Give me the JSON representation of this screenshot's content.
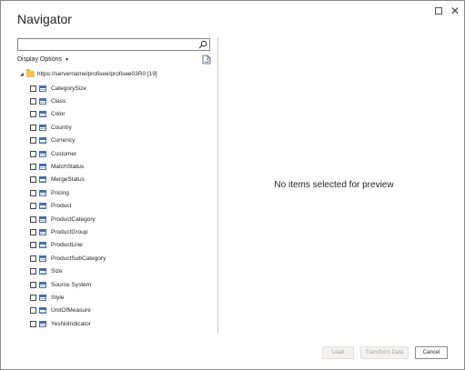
{
  "window": {
    "title": "Navigator"
  },
  "left_pane": {
    "search_placeholder": "",
    "display_options_label": "Display Options",
    "tree_root_label": "https://servername/profisee/profisee03R0 [19]",
    "items": [
      {
        "label": "CategorySize"
      },
      {
        "label": "Class"
      },
      {
        "label": "Color"
      },
      {
        "label": "Country"
      },
      {
        "label": "Currency"
      },
      {
        "label": "Customer"
      },
      {
        "label": "MatchStatus"
      },
      {
        "label": "MergeStatus"
      },
      {
        "label": "Pricing"
      },
      {
        "label": "Product"
      },
      {
        "label": "ProductCategory"
      },
      {
        "label": "ProductGroup"
      },
      {
        "label": "ProductLine"
      },
      {
        "label": "ProductSubCategory"
      },
      {
        "label": "Size"
      },
      {
        "label": "Source System"
      },
      {
        "label": "Style"
      },
      {
        "label": "UnitOfMeasure"
      },
      {
        "label": "YesNoIndicator"
      }
    ]
  },
  "preview": {
    "empty_message": "No items selected for preview"
  },
  "footer": {
    "load_label": "Load",
    "transform_label": "Transform Data",
    "cancel_label": "Cancel"
  }
}
